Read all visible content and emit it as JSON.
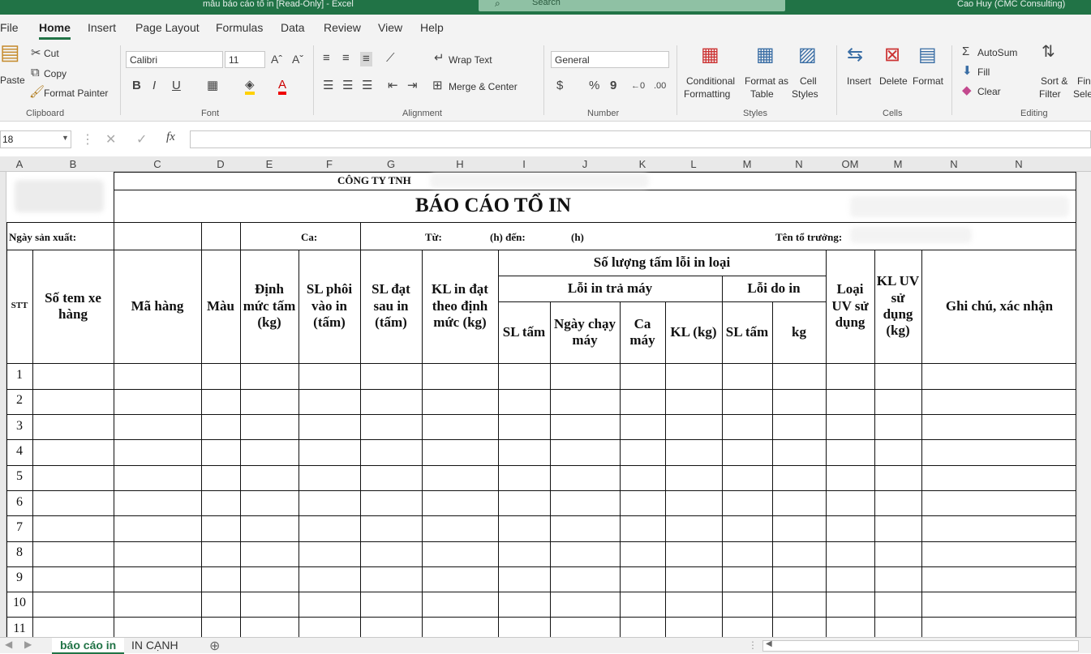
{
  "titlebar": {
    "filename": "mẫu báo cáo tổ in  [Read-Only]  -  Excel",
    "search": "Search",
    "user": "Cao Huy (CMC Consulting)"
  },
  "tabs": [
    "File",
    "Home",
    "Insert",
    "Page Layout",
    "Formulas",
    "Data",
    "Review",
    "View",
    "Help"
  ],
  "ribbon": {
    "clipboard": {
      "paste": "Paste",
      "cut": "Cut",
      "copy": "Copy",
      "format_painter": "Format Painter",
      "group": "Clipboard"
    },
    "font": {
      "name": "Calibri",
      "size": "11",
      "group": "Font"
    },
    "alignment": {
      "wrap": "Wrap Text",
      "merge": "Merge & Center",
      "group": "Alignment"
    },
    "number": {
      "format": "General",
      "group": "Number"
    },
    "styles": {
      "conditional_1": "Conditional",
      "conditional_2": "Formatting",
      "format_as_1": "Format as",
      "format_as_2": "Table",
      "cell_1": "Cell",
      "cell_2": "Styles",
      "group": "Styles"
    },
    "cells": {
      "insert": "Insert",
      "delete": "Delete",
      "format": "Format",
      "group": "Cells"
    },
    "editing": {
      "autosum": "AutoSum",
      "fill": "Fill",
      "clear": "Clear",
      "sort_1": "Sort &",
      "sort_2": "Filter",
      "find_1": "Fin",
      "find_2": "Sele",
      "group": "Editing"
    }
  },
  "formula_bar": {
    "name_box": "18",
    "fx": "fx"
  },
  "columns": [
    "A",
    "B",
    "C",
    "D",
    "E",
    "F",
    "G",
    "H",
    "I",
    "J",
    "K",
    "L",
    "M",
    "N",
    "OM",
    "M",
    "N",
    "N"
  ],
  "sheet": {
    "company": "CÔNG TY TNH",
    "title": "BÁO CÁO TỔ IN",
    "ngay_sx": "Ngày sản xuất:",
    "ca": "Ca:",
    "tu": "Từ:",
    "h_den": "(h) đến:",
    "h": "(h)",
    "to_truong": "Tên tổ trưởng:",
    "headers": {
      "stt": "STT",
      "so_tem": "Số tem xe hàng",
      "ma_hang": "Mã hàng",
      "mau": "Màu",
      "dinh_muc": "Định mức tấm (kg)",
      "sl_phoi": "SL phôi vào in (tấm)",
      "sl_dat": "SL đạt sau in (tấm)",
      "kl_in": "KL in đạt theo định mức (kg)",
      "so_luong_loi": "Số lượng tấm lỗi in loại",
      "loi_tra_may": "Lỗi in trả máy",
      "loi_do_in": "Lỗi do in",
      "sl_tam": "SL tấm",
      "ngay_chay": "Ngày chạy máy",
      "ca_may": "Ca máy",
      "kl_kg": "KL (kg)",
      "sl_tam2": "SL tấm",
      "kg": "kg",
      "loai_uv": "Loại UV sử dụng",
      "kl_uv": "KL UV sử dụng (kg)",
      "ghi_chu": "Ghi chú, xác nhận"
    },
    "rows": [
      "1",
      "2",
      "3",
      "4",
      "5",
      "6",
      "7",
      "8",
      "9",
      "10",
      "11"
    ]
  },
  "sheet_tabs": [
    "báo cáo in",
    "IN CẠNH"
  ]
}
